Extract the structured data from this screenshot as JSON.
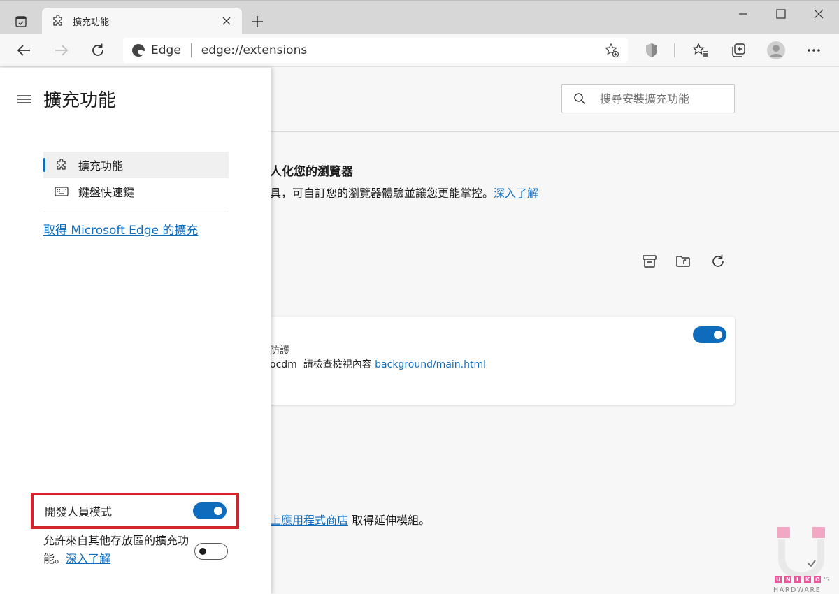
{
  "window": {
    "tab_title": "擴充功能",
    "minimize_symbol": "—",
    "maximize_symbol": "☐",
    "close_symbol": "✕"
  },
  "address_bar": {
    "site_name": "Edge",
    "url": "edge://extensions"
  },
  "side_panel": {
    "title": "擴充功能",
    "nav_items": [
      {
        "label": "擴充功能",
        "icon": "puzzle-icon",
        "active": true
      },
      {
        "label": "鍵盤快速鍵",
        "icon": "keyboard-icon",
        "active": false
      }
    ],
    "get_extensions_link": "取得 Microsoft Edge 的擴充",
    "developer_mode_label": "開發人員模式",
    "developer_mode_on": true,
    "allow_other_stores_text": "允許來自其他存放區的擴充功能。",
    "allow_other_stores_link": "深入了解",
    "allow_other_stores_on": false
  },
  "main": {
    "search_placeholder": "搜尋安裝擴充功能",
    "promo_title_fragment": "人化您的瀏覽器",
    "promo_desc_fragment": "具，可自訂您的瀏覽器體驗並讓您更能掌控。",
    "promo_link": "深入了解",
    "extension_card": {
      "desc_fragment": "防護",
      "inspect_prefix": "ocdm",
      "inspect_label": "請檢查檢視內容",
      "inspect_link": "background/main.html",
      "enabled": true
    },
    "store_link_fragment": "上應用程式商店",
    "store_suffix": " 取得延伸模組。"
  },
  "colors": {
    "accent": "#0f6cbd",
    "highlight_border": "#d6222a"
  }
}
